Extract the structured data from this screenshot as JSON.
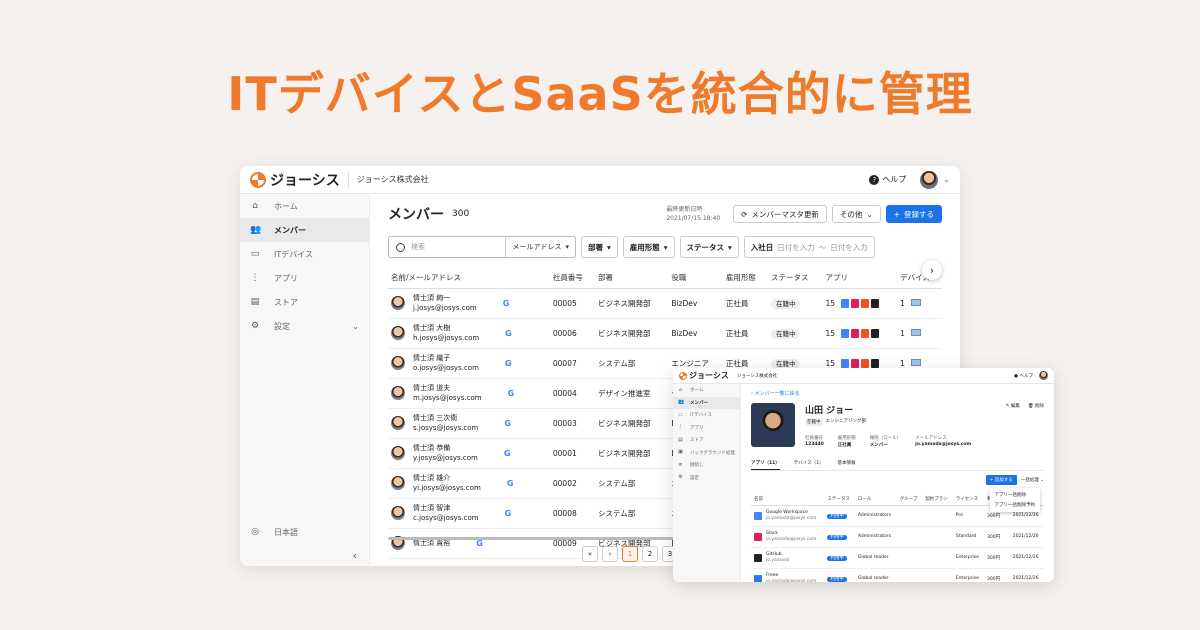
{
  "headline": "ITデバイスとSaaSを統合的に管理",
  "main": {
    "brand": "ジョーシス",
    "company": "ジョーシス株式会社",
    "help": "ヘルプ",
    "sidebar": [
      {
        "label": "ホーム",
        "icon": "home-icon",
        "glyph": "⌂"
      },
      {
        "label": "メンバー",
        "icon": "people-icon",
        "glyph": "👥"
      },
      {
        "label": "ITデバイス",
        "icon": "laptop-icon",
        "glyph": "▭"
      },
      {
        "label": "アプリ",
        "icon": "grid-icon",
        "glyph": "⋮"
      },
      {
        "label": "ストア",
        "icon": "store-icon",
        "glyph": "▤"
      },
      {
        "label": "設定",
        "icon": "gear-icon",
        "glyph": "⚙"
      }
    ],
    "lang": "日本語",
    "title": "メンバー",
    "count": "300",
    "updated_label": "最終更新日時",
    "updated_value": "2021/07/15 18:40",
    "refresh_button": "メンバーマスタ更新",
    "other_button": "その他",
    "register_button": "登録する",
    "search_placeholder": "検索",
    "search_field": "メールアドレス",
    "filters": [
      "部署",
      "雇用形態",
      "ステータス"
    ],
    "join_label": "入社日",
    "date_from": "日付を入力",
    "date_to": "日付を入力",
    "columns": [
      "名前/メールアドレス",
      "社員番号",
      "部署",
      "役職",
      "雇用形態",
      "ステータス",
      "アプリ",
      "デバイス"
    ],
    "rows": [
      {
        "name": "情士須 絢一",
        "email": "j.josys@josys.com",
        "id": "00005",
        "dept": "ビジネス開発部",
        "role": "BizDev",
        "type": "正社員",
        "status": "在籍中",
        "apps": "15",
        "devices": "1"
      },
      {
        "name": "情士須 大樹",
        "email": "h.josys@josys.com",
        "id": "00006",
        "dept": "ビジネス開発部",
        "role": "BizDev",
        "type": "正社員",
        "status": "在籍中",
        "apps": "15",
        "devices": "1"
      },
      {
        "name": "情士須 織子",
        "email": "o.josys@josys.com",
        "id": "00007",
        "dept": "システム部",
        "role": "エンジニア",
        "type": "正社員",
        "status": "在籍中",
        "apps": "15",
        "devices": "1"
      },
      {
        "name": "情士須 道夫",
        "email": "m.josys@josys.com",
        "id": "00004",
        "dept": "デザイン推進室",
        "role": "デザイナ",
        "type": "",
        "status": "",
        "apps": "",
        "devices": ""
      },
      {
        "name": "情士須 三次衛",
        "email": "s.josys@josys.com",
        "id": "00003",
        "dept": "ビジネス開発部",
        "role": "BizDev",
        "type": "",
        "status": "",
        "apps": "",
        "devices": ""
      },
      {
        "name": "情士須 恭備",
        "email": "y.josys@josys.com",
        "id": "00001",
        "dept": "ビジネス開発部",
        "role": "BizDev",
        "type": "",
        "status": "",
        "apps": "",
        "devices": ""
      },
      {
        "name": "情士須 雄介",
        "email": "yi.josys@josys.com",
        "id": "00002",
        "dept": "システム部",
        "role": "エンジニ",
        "type": "",
        "status": "",
        "apps": "",
        "devices": ""
      },
      {
        "name": "情士須 智津",
        "email": "c.josys@josys.com",
        "id": "00008",
        "dept": "システム部",
        "role": "エンジニ",
        "type": "",
        "status": "",
        "apps": "",
        "devices": ""
      },
      {
        "name": "情士須 貴裕",
        "email": "",
        "id": "00009",
        "dept": "ビジネス開発部",
        "role": "BizDev",
        "type": "",
        "status": "",
        "apps": "",
        "devices": ""
      }
    ],
    "pages": [
      "1",
      "2",
      "3"
    ]
  },
  "detail": {
    "brand": "ジョーシス",
    "company": "ジョーシス株式会社",
    "help": "ヘルプ",
    "sidebar": [
      "ホーム",
      "メンバー",
      "ITデバイス",
      "アプリ",
      "ストア",
      "バックグラウンド処理",
      "接続し",
      "設定"
    ],
    "back": "メンバー一覧に戻る",
    "name": "山田 ジョー",
    "tag1": "在籍中",
    "tag2": "エンジニアリング部",
    "edit": "編集",
    "delete": "削除",
    "fields": [
      {
        "label": "社員番号",
        "value": "123440"
      },
      {
        "label": "雇用形態",
        "value": "正社員"
      },
      {
        "label": "権限（ロール）",
        "value": "メンバー"
      },
      {
        "label": "メールアドレス",
        "value": "jo.yamada@josys.com"
      }
    ],
    "tabs": [
      "アプリ（11）",
      "デバイス（1）",
      "基本情報"
    ],
    "add_button": "追加する",
    "bulk": "一括処理",
    "menu": [
      "アプリ一括削除",
      "アプリ一括削除予約"
    ],
    "columns": [
      "名前",
      "ステータス",
      "ロール",
      "グループ",
      "契約プラン",
      "ライセンス",
      "利用料金",
      ""
    ],
    "apps": [
      {
        "name": "Google Workspace",
        "sub": "jo.yamada@josys.com",
        "status": "利用中",
        "role": "Administrators",
        "plan": "Pro",
        "fee": "300円",
        "date": "2021/12/26"
      },
      {
        "name": "Slack",
        "sub": "jo.yamada@josys.com",
        "status": "利用中",
        "role": "Administrators",
        "plan": "Standard",
        "fee": "300円",
        "date": "2021/12/26"
      },
      {
        "name": "GitHub",
        "sub": "jo.yamada",
        "status": "利用中",
        "role": "Global reader",
        "plan": "Enterprise",
        "fee": "300円",
        "date": "2021/12/26"
      },
      {
        "name": "Freee",
        "sub": "jo.yamada@josys.com",
        "status": "利用中",
        "role": "Global reader",
        "plan": "Enterprise",
        "fee": "300円",
        "date": "2021/12/26"
      }
    ]
  },
  "colors": {
    "accent": "#f07a2c",
    "primary": "#1a73e8"
  }
}
